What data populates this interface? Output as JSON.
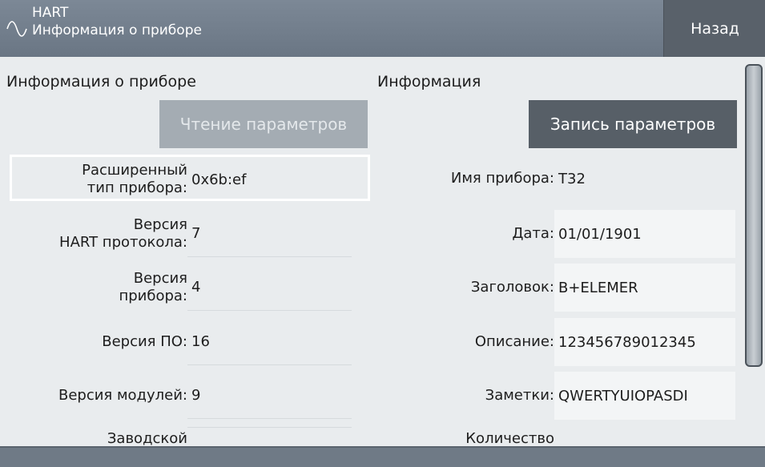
{
  "header": {
    "title": "HART",
    "subtitle": "Информация о приборе",
    "back_label": "Назад",
    "icon": "sine-wave-icon"
  },
  "left": {
    "title": "Информация о приборе",
    "read_button": "Чтение параметров",
    "rows": [
      {
        "label1": "Расширенный",
        "label2": "тип прибора:",
        "value": "0x6b:ef"
      },
      {
        "label1": "Версия",
        "label2": "HART протокола:",
        "value": "7"
      },
      {
        "label1": "Версия",
        "label2": "прибора:",
        "value": "4"
      },
      {
        "label1": "Версия ПО:",
        "label2": "",
        "value": "16"
      },
      {
        "label1": "Версия модулей:",
        "label2": "",
        "value": "9"
      },
      {
        "label1": "Заводской",
        "label2": "",
        "value": ""
      }
    ]
  },
  "right": {
    "title": "Информация",
    "write_button": "Запись параметров",
    "rows": [
      {
        "label": "Имя прибора:",
        "value": "T32"
      },
      {
        "label": "Дата:",
        "value": "01/01/1901"
      },
      {
        "label": "Заголовок:",
        "value": "B+ELEMER"
      },
      {
        "label": "Описание:",
        "value": "123456789012345"
      },
      {
        "label": "Заметки:",
        "value": "QWERTYUIOPASDI"
      },
      {
        "label": "Количество",
        "value": ""
      }
    ]
  }
}
